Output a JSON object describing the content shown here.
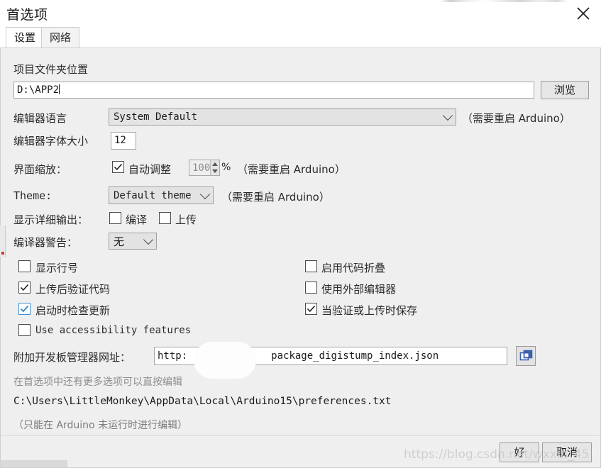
{
  "window": {
    "title": "首选项",
    "close_icon": "close-icon"
  },
  "tabs": [
    {
      "label": "设置",
      "active": true
    },
    {
      "label": "网络",
      "active": false
    }
  ],
  "settings": {
    "sketchbook": {
      "label": "项目文件夹位置",
      "value": "D:\\APP2",
      "browse_label": "浏览"
    },
    "editor_language": {
      "label": "编辑器语言",
      "value": "System Default",
      "note": "（需要重启 Arduino）"
    },
    "editor_font_size": {
      "label": "编辑器字体大小",
      "value": "12"
    },
    "interface_scale": {
      "label": "界面缩放：",
      "auto_label": "自动调整",
      "auto_checked": true,
      "percent_value": "100",
      "percent_suffix": "%",
      "note": "（需要重启 Arduino）"
    },
    "theme": {
      "label": "Theme:",
      "value": "Default theme",
      "note": "（需要重启 Arduino）"
    },
    "verbose_output": {
      "label": "显示详细输出：",
      "compile_label": "编译",
      "compile_checked": false,
      "upload_label": "上传",
      "upload_checked": false
    },
    "compiler_warnings": {
      "label": "编译器警告：",
      "value": "无"
    },
    "checkboxes_left": [
      {
        "label": "显示行号",
        "checked": false,
        "style": "dark",
        "mono": false
      },
      {
        "label": "上传后验证代码",
        "checked": true,
        "style": "dark",
        "mono": false
      },
      {
        "label": "启动时检查更新",
        "checked": true,
        "style": "blue",
        "mono": false
      },
      {
        "label": "Use accessibility features",
        "checked": false,
        "style": "dark",
        "mono": true
      }
    ],
    "checkboxes_right": [
      {
        "label": "启用代码折叠",
        "checked": false,
        "style": "dark",
        "mono": false
      },
      {
        "label": "使用外部编辑器",
        "checked": false,
        "style": "dark",
        "mono": false
      },
      {
        "label": "当验证或上传时保存",
        "checked": true,
        "style": "dark",
        "mono": false
      }
    ],
    "board_urls": {
      "label": "附加开发板管理器网址：",
      "value_left": "http:",
      "value_right": "package_digistump_index.json",
      "edit_icon": "window-edit-icon"
    },
    "more_prefs_hint": "在首选项中还有更多选项可以直按编辑",
    "prefs_path": "C:\\Users\\LittleMonkey\\AppData\\Local\\Arduino15\\preferences.txt",
    "prefs_note": "（只能在 Arduino 未运行时进行编辑）"
  },
  "footer": {
    "ok_label": "好",
    "cancel_label": "取消"
  },
  "overlay": {
    "watermark": "https://blog.csdn.net/wxxin_45"
  },
  "colors": {
    "window_bg": "#efefef",
    "titlebar_bg": "#ffffff",
    "border": "#cdcdcd",
    "text": "#2b2b2b",
    "accent_blue": "#3c8fd4",
    "icon_blue": "#3b5fad"
  }
}
